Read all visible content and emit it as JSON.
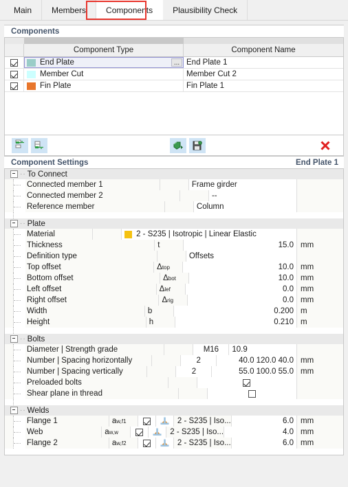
{
  "tabs": [
    {
      "label": "Main",
      "active": false
    },
    {
      "label": "Members",
      "active": false
    },
    {
      "label": "Components",
      "active": true
    },
    {
      "label": "Plausibility Check",
      "active": false
    }
  ],
  "components_section": {
    "title": "Components",
    "columns": [
      "Component Type",
      "Component Name"
    ],
    "rows": [
      {
        "checked": true,
        "color": "#9ACDC8",
        "type": "End Plate",
        "name": "End Plate 1",
        "selected": true,
        "ellipsis": "..."
      },
      {
        "checked": true,
        "color": "#CCFFFF",
        "type": "Member Cut",
        "name": "Member Cut 2",
        "selected": false,
        "ellipsis": ""
      },
      {
        "checked": true,
        "color": "#E8762C",
        "type": "Fin Plate",
        "name": "Fin Plate 1",
        "selected": false,
        "ellipsis": ""
      }
    ]
  },
  "toolbar": {
    "insert_row_above_title": "Insert Row Above",
    "insert_row_below_title": "Insert Row Below",
    "import_title": "Import Component",
    "save_title": "Save Component",
    "delete_title": "Delete"
  },
  "settings_section": {
    "title": "Component Settings",
    "selected_component": "End Plate 1"
  },
  "groups": [
    {
      "name": "To Connect",
      "rows": [
        {
          "label": "Connected member 1",
          "symbol": "",
          "value": "Frame girder",
          "unit": ""
        },
        {
          "label": "Connected member 2",
          "symbol": "",
          "value": "--",
          "unit": ""
        },
        {
          "label": "Reference member",
          "symbol": "",
          "value": "Column",
          "unit": ""
        }
      ]
    },
    {
      "name": "Plate",
      "rows": [
        {
          "label": "Material",
          "symbol": "",
          "value": "2 - S235 | Isotropic | Linear Elastic",
          "unit": "",
          "swatch": "#F5C211"
        },
        {
          "label": "Thickness",
          "symbol": "t",
          "value": "15.0",
          "unit": "mm",
          "numeric": true
        },
        {
          "label": "Definition type",
          "symbol": "",
          "value": "Offsets",
          "unit": ""
        },
        {
          "label": "Top offset",
          "symbol_base": "Δ",
          "symbol_sub": "top",
          "value": "10.0",
          "unit": "mm",
          "numeric": true
        },
        {
          "label": "Bottom offset",
          "symbol_base": "Δ",
          "symbol_sub": "bot",
          "value": "10.0",
          "unit": "mm",
          "numeric": true
        },
        {
          "label": "Left offset",
          "symbol_base": "Δ",
          "symbol_sub": "lef",
          "value": "0.0",
          "unit": "mm",
          "numeric": true
        },
        {
          "label": "Right offset",
          "symbol_base": "Δ",
          "symbol_sub": "rig",
          "value": "0.0",
          "unit": "mm",
          "numeric": true
        },
        {
          "label": "Width",
          "symbol": "b",
          "value": "0.200",
          "unit": "m",
          "numeric": true
        },
        {
          "label": "Height",
          "symbol": "h",
          "value": "0.210",
          "unit": "m",
          "numeric": true
        }
      ]
    },
    {
      "name": "Bolts",
      "rows": [
        {
          "label": "Diameter | Strength grade",
          "col_a": "M16",
          "value": "10.9",
          "unit": "",
          "align": "left"
        },
        {
          "label": "Number | Spacing horizontally",
          "col_a": "2",
          "value": "40.0 120.0 40.0",
          "unit": "mm",
          "align": "right"
        },
        {
          "label": "Number | Spacing vertically",
          "col_a": "2",
          "value": "55.0 100.0 55.0",
          "unit": "mm",
          "align": "right"
        },
        {
          "label": "Preloaded bolts",
          "checkbox": true,
          "checked": true
        },
        {
          "label": "Shear plane in thread",
          "checkbox": true,
          "checked": false
        }
      ]
    },
    {
      "name": "Welds",
      "rows": [
        {
          "label": "Flange 1",
          "symbol_base": "a",
          "symbol_sub": "w,f1",
          "checked": true,
          "material": "2 - S235 | Iso...",
          "value": "6.0",
          "unit": "mm"
        },
        {
          "label": "Web",
          "symbol_base": "a",
          "symbol_sub": "w,w",
          "checked": true,
          "material": "2 - S235 | Iso...",
          "value": "4.0",
          "unit": "mm"
        },
        {
          "label": "Flange 2",
          "symbol_base": "a",
          "symbol_sub": "w,f2",
          "checked": true,
          "material": "2 - S235 | Iso...",
          "value": "6.0",
          "unit": "mm"
        }
      ]
    }
  ],
  "colors": {
    "accent_header": "#44546A",
    "highlight_red": "#E8352D",
    "toolbar_button_bg": "#CFE4F5",
    "material_yellow": "#F5C211"
  }
}
